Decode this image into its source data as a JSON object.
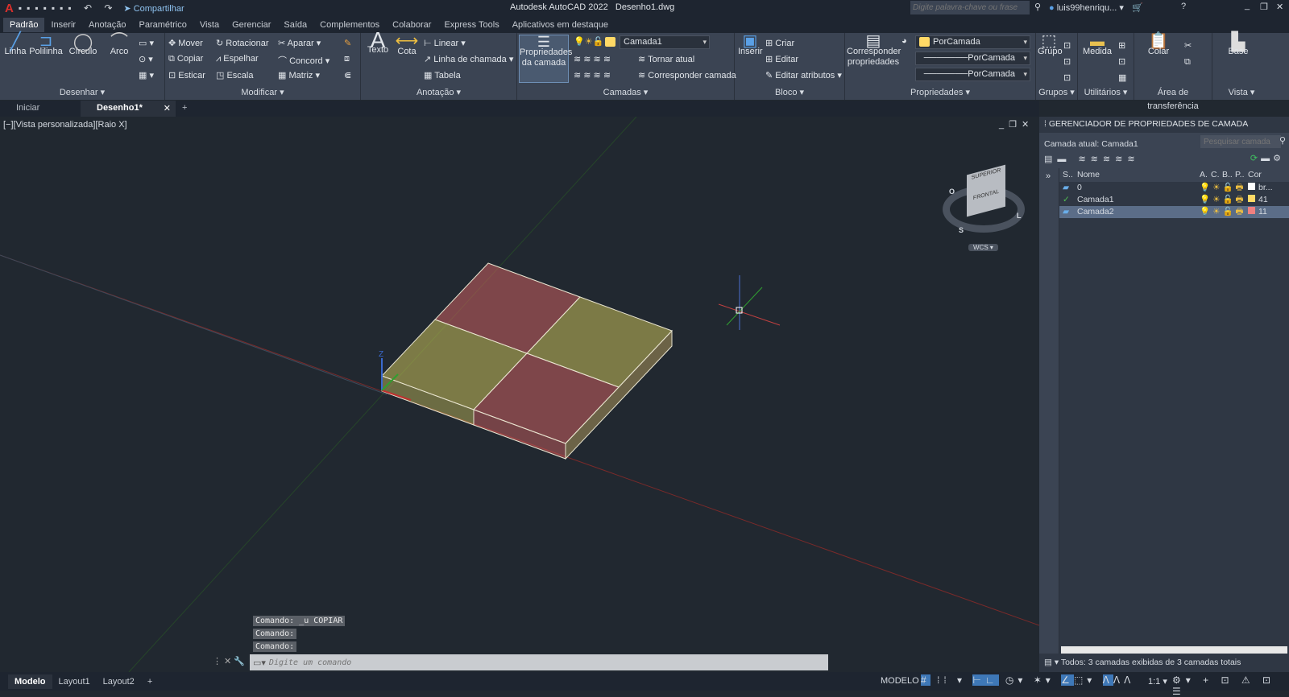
{
  "title_bar": {
    "app_title": "Autodesk AutoCAD 2022",
    "file_name": "Desenho1.dwg",
    "share_label": "Compartilhar",
    "search_placeholder": "Digite palavra-chave ou frase",
    "user": "luis99henriqu..."
  },
  "ribbon_tabs": [
    "Padrão",
    "Inserir",
    "Anotação",
    "Paramétrico",
    "Vista",
    "Gerenciar",
    "Saída",
    "Complementos",
    "Colaborar",
    "Express Tools",
    "Aplicativos em destaque"
  ],
  "ribbon": {
    "desenhar": {
      "title": "Desenhar",
      "tools": [
        "Linha",
        "Polilinha",
        "Círculo",
        "Arco"
      ]
    },
    "modificar": {
      "title": "Modificar",
      "tools": [
        "Mover",
        "Rotacionar",
        "Aparar",
        "Copiar",
        "Espelhar",
        "Concord",
        "Esticar",
        "Escala",
        "Matriz"
      ]
    },
    "anotacao": {
      "title": "Anotação",
      "tools": [
        "Texto",
        "Cota",
        "Linear",
        "Linha de chamada",
        "Tabela"
      ]
    },
    "camadas": {
      "title": "Camadas",
      "layer_props": "Propriedades da camada",
      "current_layer": "Camada1",
      "tools": [
        "Tornar atual",
        "Corresponder camada"
      ]
    },
    "bloco": {
      "title": "Bloco",
      "insert": "Inserir",
      "tools": [
        "Criar",
        "Editar",
        "Editar atributos"
      ]
    },
    "propriedades": {
      "title": "Propriedades",
      "match": "Corresponder propriedades",
      "color": "PorCamada",
      "linetype": "PorCamada",
      "lineweight": "PorCamada"
    },
    "grupos": {
      "title": "Grupos",
      "group": "Grupo"
    },
    "utilitarios": {
      "title": "Utilitários",
      "measure": "Medida"
    },
    "area": {
      "title": "Área de transferência",
      "paste": "Colar"
    },
    "vista": {
      "title": "Vista",
      "base": "Base"
    }
  },
  "doc_tabs": [
    "Iniciar",
    "Desenho1*"
  ],
  "viewport": {
    "label": "[−][Vista personalizada][Raio X]",
    "viewcube_top": "SUPERIOR",
    "viewcube_front": "FRONTAL",
    "compass": [
      "O",
      "S",
      "L"
    ],
    "wcs": "WCS"
  },
  "command": {
    "history": [
      "Comando: _u COPIAR",
      "Comando:",
      "Comando:"
    ],
    "placeholder": "Digite um comando"
  },
  "layer_palette": {
    "title": "GERENCIADOR DE PROPRIEDADES DE CAMADA",
    "current": "Camada atual: Camada1",
    "search_placeholder": "Pesquisar camada",
    "columns": [
      "S..",
      "Nome",
      "A.",
      "C.",
      "B..",
      "P..",
      "Cor"
    ],
    "layers": [
      {
        "name": "0",
        "color": "br...",
        "swatch": "#ffffff",
        "current": false,
        "selected": false
      },
      {
        "name": "Camada1",
        "color": "41",
        "swatch": "#ffd966",
        "current": true,
        "selected": false
      },
      {
        "name": "Camada2",
        "color": "11",
        "swatch": "#f08080",
        "current": false,
        "selected": true
      }
    ],
    "status": "Todos: 3 camadas exibidas de 3 camadas totais"
  },
  "status_bar": {
    "layout_tabs": [
      "Modelo",
      "Layout1",
      "Layout2"
    ],
    "model": "MODELO",
    "scale": "1:1"
  }
}
